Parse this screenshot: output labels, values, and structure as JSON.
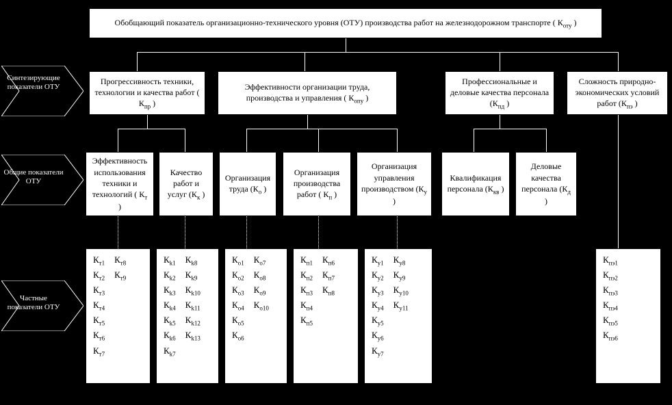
{
  "top": {
    "text": "Обобщающий показатель организационно-технического уровня (ОТУ) производства работ на железнодорожном транспорте ( К",
    "sub": "оту",
    "close": " )"
  },
  "labels": {
    "synth": "Синтезиру­ющие показатели ОТУ",
    "general": "Общие показатели ОТУ",
    "private": "Частные показатели ОТУ"
  },
  "synth": [
    {
      "t": "Прогрессивность техники, технологии и качества работ ( К",
      "s": "пр",
      "c": " )"
    },
    {
      "t": "Эффективности организации труда, производства и управления ( К",
      "s": "опу",
      "c": " )"
    },
    {
      "t": "Профессиональные и деловые качества персонала (К",
      "s": "пд",
      "c": " )"
    },
    {
      "t": "Сложность природно-экономических условий работ (К",
      "s": "пэ",
      "c": " )"
    }
  ],
  "general": [
    {
      "t": "Эффективность использования техники и технологий ( К",
      "s": "т",
      "c": " )"
    },
    {
      "t": "Качество работ и услуг (К",
      "s": "к",
      "c": " )"
    },
    {
      "t": "Организация труда (К",
      "s": "о",
      "c": " )"
    },
    {
      "t": "Организация производства работ ( К",
      "s": "п",
      "c": " )"
    },
    {
      "t": "Организация управления производством (К",
      "s": "у",
      "c": " )"
    },
    {
      "t": "Квалификация персонала (К",
      "s": "кв",
      "c": " )"
    },
    {
      "t": "Деловые качества персонала (К",
      "s": "д",
      "c": " )"
    }
  ],
  "private": {
    "t": {
      "cols": [
        [
          "т1",
          "т2",
          "т3",
          "т4",
          "т5",
          "т6",
          "т7"
        ],
        [
          "т8",
          "т9"
        ]
      ]
    },
    "k": {
      "cols": [
        [
          "k1",
          "k2",
          "k3",
          "k4",
          "k5",
          "k6",
          "k7"
        ],
        [
          "k8",
          "k9",
          "k10",
          "k11",
          "k12",
          "k13"
        ]
      ]
    },
    "o": {
      "cols": [
        [
          "о1",
          "о2",
          "о3",
          "о4",
          "о5",
          "о6"
        ],
        [
          "о7",
          "о8",
          "о9",
          "о10"
        ]
      ]
    },
    "p": {
      "cols": [
        [
          "п1",
          "п2",
          "п3",
          "п4",
          "п5"
        ],
        [
          "п6",
          "п7",
          "п8"
        ]
      ]
    },
    "y": {
      "cols": [
        [
          "у1",
          "у2",
          "у3",
          "у4",
          "у5",
          "у6",
          "у7"
        ],
        [
          "у8",
          "у9",
          "у10",
          "у11"
        ]
      ]
    },
    "pe": {
      "cols": [
        [
          "пэ1",
          "пэ2",
          "пэ3",
          "пэ4",
          "пэ5",
          "пэ6"
        ]
      ]
    }
  }
}
